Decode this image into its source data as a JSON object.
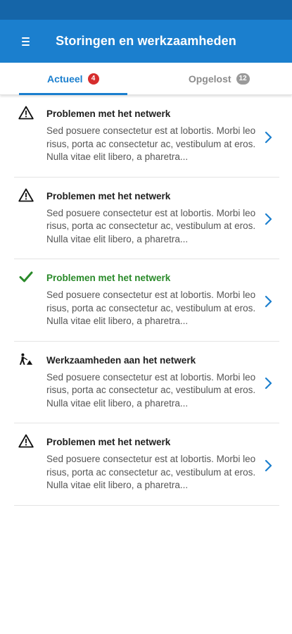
{
  "app_bar": {
    "title": "Storingen en werkzaamheden",
    "menu_icon": "hamburger-menu-icon",
    "color": "#1b7fce"
  },
  "tabs": [
    {
      "label": "Actueel",
      "badge": "4",
      "active": true
    },
    {
      "label": "Opgelost",
      "badge": "12",
      "active": false
    }
  ],
  "items": [
    {
      "icon": "warning-triangle-icon",
      "title": "Problemen met het netwerk",
      "description": "Sed posuere consectetur est at lobortis. Morbi leo risus, porta ac consectetur ac, vestibulum at eros. Nulla vitae elit libero, a pharetra..."
    },
    {
      "icon": "warning-triangle-icon",
      "title": "Problemen met het netwerk",
      "description": "Sed posuere consectetur est at lobortis. Morbi leo risus, porta ac consectetur ac, vestibulum at eros. Nulla vitae elit libero, a pharetra..."
    },
    {
      "icon": "checkmark-icon",
      "title": "Problemen met het netwerk",
      "description": "Sed posuere consectetur est at lobortis. Morbi leo risus, porta ac consectetur ac, vestibulum at eros. Nulla vitae elit libero, a pharetra...",
      "status_color": "#2a8a2a"
    },
    {
      "icon": "roadwork-icon",
      "title": "Werkzaamheden aan het netwerk",
      "description": "Sed posuere consectetur est at lobortis. Morbi leo risus, porta ac consectetur ac, vestibulum at eros. Nulla vitae elit libero, a pharetra..."
    },
    {
      "icon": "warning-triangle-icon",
      "title": "Problemen met het netwerk",
      "description": "Sed posuere consectetur est at lobortis. Morbi leo risus, porta ac consectetur ac, vestibulum at eros. Nulla vitae elit libero, a pharetra..."
    }
  ]
}
